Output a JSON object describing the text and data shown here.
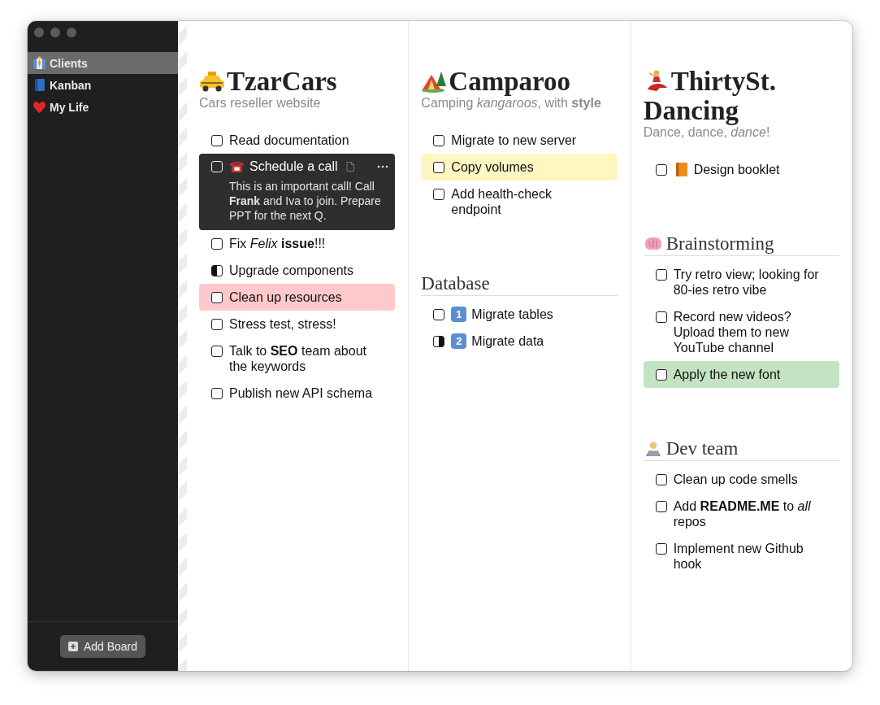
{
  "sidebar": {
    "boards": [
      {
        "label": "Clients",
        "kind": "worker",
        "selected": true
      },
      {
        "label": "Kanban",
        "kind": "book",
        "selected": false
      },
      {
        "label": "My Life",
        "kind": "heart",
        "selected": false
      }
    ],
    "add_button": "Add Board"
  },
  "columns": [
    {
      "title": "TzarCars",
      "kind": "taxi",
      "subtitle": "Cars reseller website",
      "tasks": [
        {
          "text": "Read documentation",
          "kind": "plain",
          "started": false,
          "halted": false,
          "selected": false
        },
        {
          "text": "Schedule a call",
          "kind": "phone",
          "started": false,
          "halted": false,
          "selected": true,
          "note": "This is an important call! Call **Frank** and Iva to join. Prepare PPT for the next Q."
        },
        {
          "text": "Fix *Felix* **issue**!!!",
          "kind": "plain",
          "started": false,
          "halted": false,
          "selected": false
        },
        {
          "text": "Upgrade components",
          "kind": "plain",
          "started": true,
          "halted": false,
          "selected": false
        },
        {
          "text": "Clean up resources",
          "kind": "plain",
          "started": false,
          "halted": false,
          "selected": false,
          "color": "#ffc9cc"
        },
        {
          "text": "Stress test, stress!",
          "kind": "plain",
          "started": false,
          "halted": false,
          "selected": false
        },
        {
          "text": "Talk to **SEO** team about the keywords",
          "kind": "plain",
          "started": false,
          "halted": false,
          "selected": false
        },
        {
          "text": "Publish new API schema",
          "kind": "plain",
          "started": false,
          "halted": false,
          "selected": false
        }
      ]
    },
    {
      "title": "Camparoo",
      "kind": "tent",
      "subtitle": "Camping *kangaroos*, with **style**",
      "tasks": [
        {
          "text": "Migrate to new server",
          "kind": "plain",
          "started": false,
          "halted": false,
          "selected": false
        },
        {
          "text": "Copy volumes",
          "kind": "plain",
          "started": false,
          "halted": false,
          "selected": false,
          "color": "#fff6c2"
        },
        {
          "text": "Add health-check endpoint",
          "kind": "plain",
          "started": false,
          "halted": false,
          "selected": false
        }
      ],
      "sections": [
        {
          "heading": "Database",
          "kind": "plain",
          "tasks": [
            {
              "text": "Migrate tables",
              "kind": "keycap",
              "badge": "1",
              "started": false,
              "halted": false,
              "selected": false
            },
            {
              "text": "Migrate data",
              "kind": "keycap",
              "badge": "2",
              "started": false,
              "halted": true,
              "selected": false
            }
          ]
        }
      ]
    },
    {
      "title": "ThirtySt. Dancing",
      "kind": "dancer",
      "subtitle": "Dance, dance, *dance*!",
      "tasks": [
        {
          "text": "Design booklet",
          "kind": "book",
          "started": false,
          "halted": false,
          "selected": false
        }
      ],
      "sections": [
        {
          "heading": "Brainstorming",
          "kind": "brain",
          "tasks": [
            {
              "text": "Try retro view; looking for 80-ies retro vibe",
              "kind": "plain",
              "started": false,
              "halted": false,
              "selected": false
            },
            {
              "text": "Record new videos? Upload them to new YouTube channel",
              "kind": "plain",
              "started": false,
              "halted": false,
              "selected": false
            },
            {
              "text": "Apply the new font",
              "kind": "plain",
              "started": false,
              "halted": false,
              "selected": false,
              "color": "#c3e3c3"
            }
          ]
        },
        {
          "heading": "Dev team",
          "kind": "person",
          "tasks": [
            {
              "text": "Clean up code smells",
              "kind": "plain",
              "started": false,
              "halted": false,
              "selected": false
            },
            {
              "text": "Add **README.ME** to *all* repos",
              "kind": "plain",
              "started": false,
              "halted": false,
              "selected": false
            },
            {
              "text": "Implement new Github hook",
              "kind": "plain",
              "started": false,
              "halted": false,
              "selected": false
            }
          ]
        }
      ]
    }
  ]
}
